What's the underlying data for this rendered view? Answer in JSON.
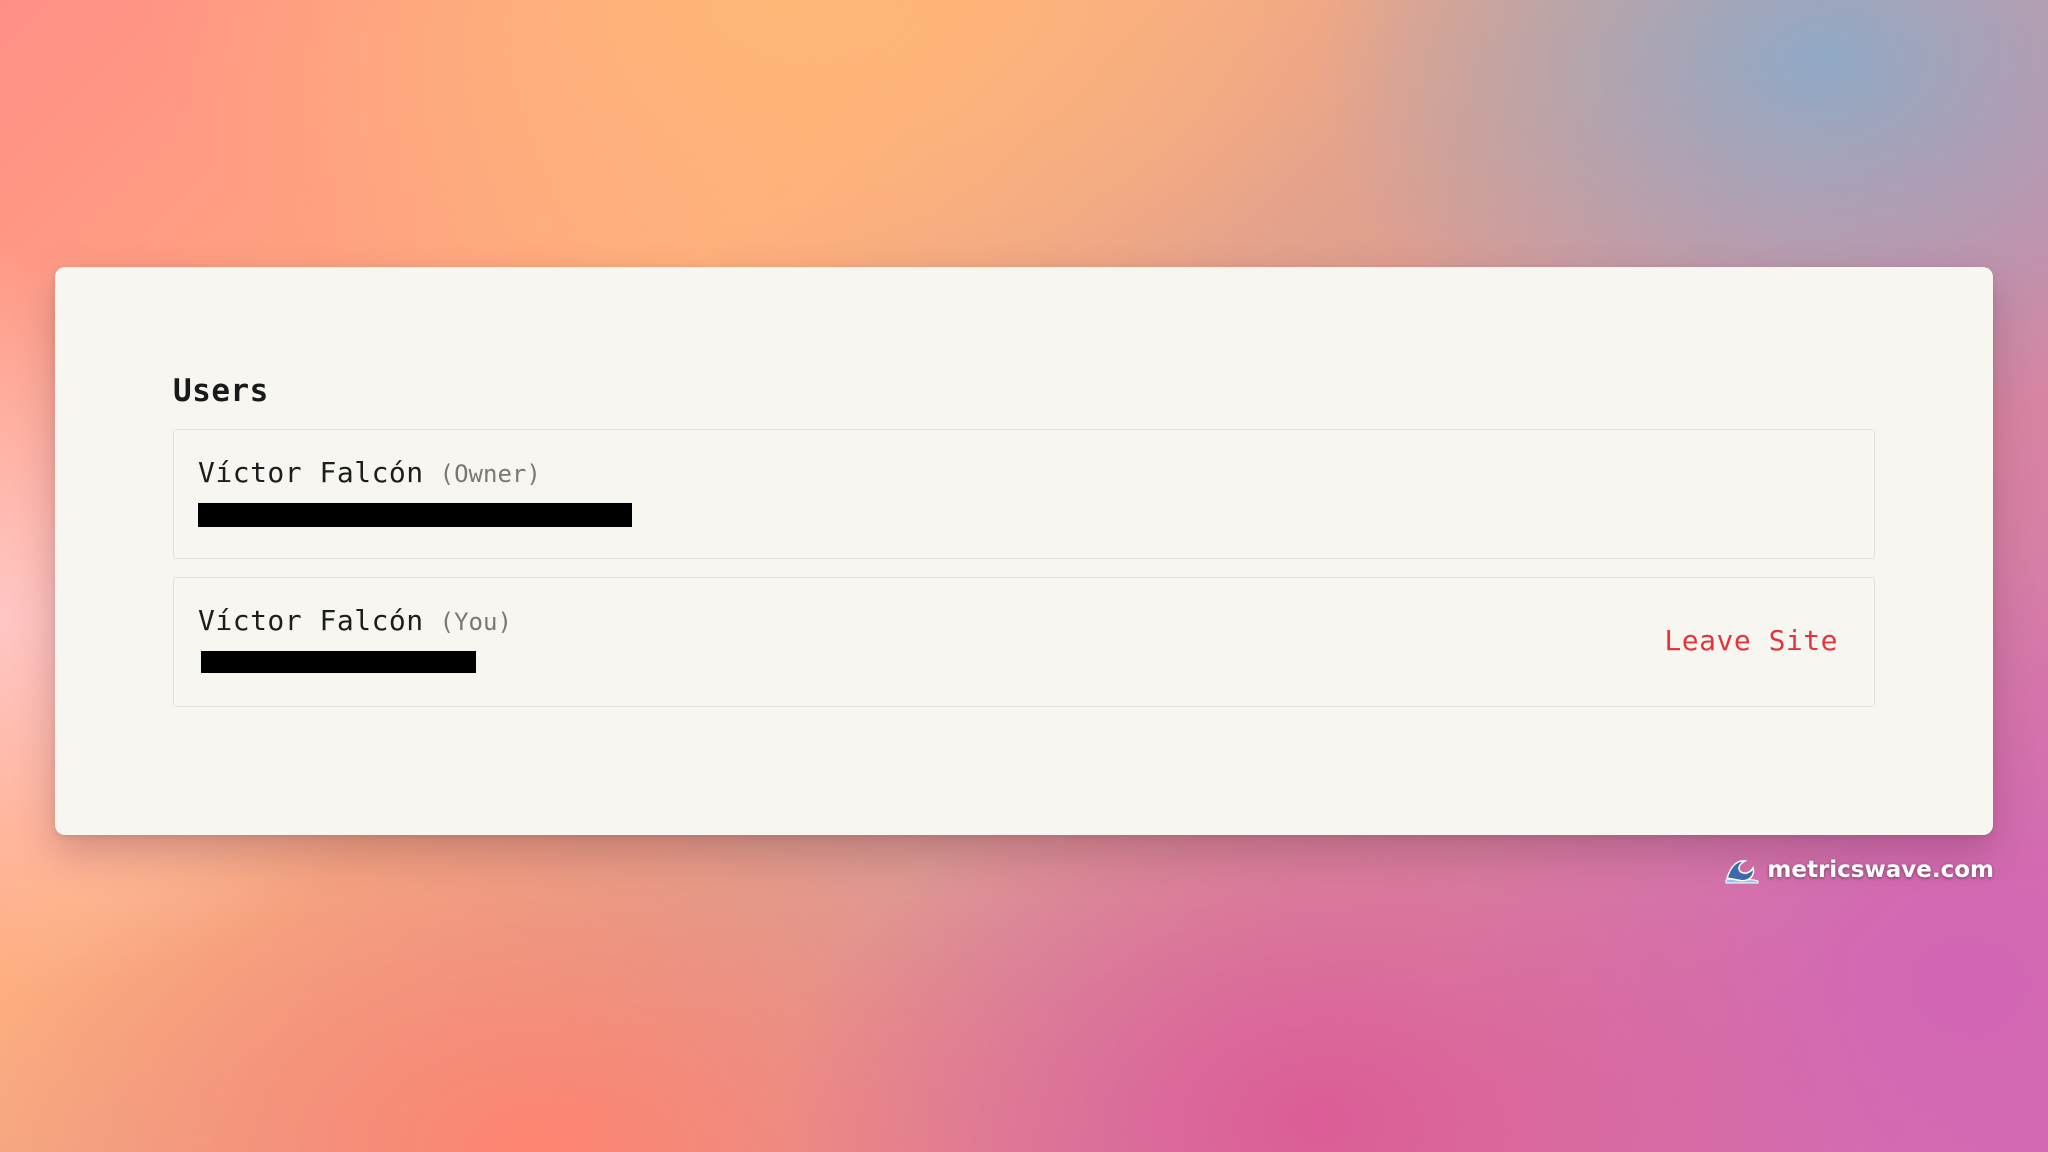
{
  "users_section": {
    "title": "Users",
    "users": [
      {
        "name": "Víctor Falcón",
        "role": "(Owner)"
      },
      {
        "name": "Víctor Falcón",
        "role": "(You)",
        "action_label": "Leave Site"
      }
    ]
  },
  "watermark": {
    "icon": "wave-icon",
    "text": "metricswave.com"
  },
  "colors": {
    "danger": "#e2363c",
    "card_background": "#f7f6f1"
  }
}
